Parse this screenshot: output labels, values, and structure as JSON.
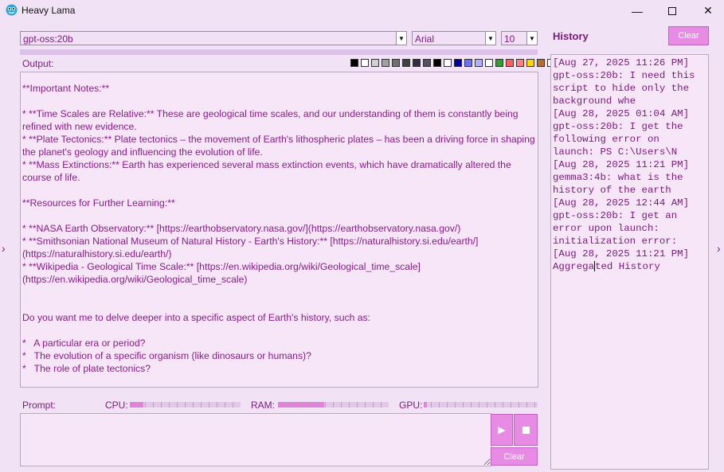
{
  "window": {
    "title": "Heavy Lama",
    "app_icon": "llama-icon",
    "minimize_glyph": "—",
    "close_glyph": "✕"
  },
  "toolbar": {
    "model": "gpt-oss:20b",
    "font": "Arial",
    "font_size": "10",
    "dropdown_glyph": "▼"
  },
  "output": {
    "label": "Output:",
    "color_swatches": [
      "#000000",
      "#ffffff",
      "#d0d0d0",
      "#a0a0a0",
      "#707070",
      "#404040",
      "#303040",
      "#505060",
      "#000000",
      "#ffffff",
      "#0000a0",
      "#7070ff",
      "#b0b0ff",
      "#ffffff",
      "#30a030",
      "#ff6060",
      "#ff8080",
      "#ffd700",
      "#b07030",
      "#ffffff"
    ],
    "text": "**Important Notes:**\n\n* **Time Scales are Relative:** These are geological time scales, and our understanding of them is constantly being refined with new evidence.\n* **Plate Tectonics:** Plate tectonics – the movement of Earth's lithospheric plates – has been a driving force in shaping the planet's geology and influencing the evolution of life.\n* **Mass Extinctions:** Earth has experienced several mass extinction events, which have dramatically altered the course of life.\n\n**Resources for Further Learning:**\n\n* **NASA Earth Observatory:** [https://earthobservatory.nasa.gov/](https://earthobservatory.nasa.gov/)\n* **Smithsonian National Museum of Natural History - Earth's History:** [https://naturalhistory.si.edu/earth/](https://naturalhistory.si.edu/earth/)\n* **Wikipedia - Geological Time Scale:** [https://en.wikipedia.org/wiki/Geological_time_scale](https://en.wikipedia.org/wiki/Geological_time_scale)\n\n\nDo you want me to delve deeper into a specific aspect of Earth's history, such as:\n\n*   A particular era or period?\n*   The evolution of a specific organism (like dinosaurs or humans)?\n*   The role of plate tectonics?"
  },
  "status": {
    "prompt_label": "Prompt:",
    "cpu_label": "CPU:",
    "cpu_level": 0.12,
    "ram_label": "RAM:",
    "ram_level": 0.42,
    "gpu_label": "GPU:",
    "gpu_level": 0.03
  },
  "prompt": {
    "value": "",
    "send_glyph": "▶",
    "clear_label": "Clear"
  },
  "history": {
    "title": "History",
    "clear_label": "Clear",
    "lines": [
      "[Aug 27, 2025 11:26 PM]",
      "gpt-oss:20b: I need this",
      "script to hide only the",
      "background whe",
      "[Aug 28, 2025 01:04 AM]",
      "gpt-oss:20b: I get the",
      "following error on",
      "launch: PS C:\\Users\\N",
      "[Aug 28, 2025 11:21 PM]",
      "gemma3:4b: what is the",
      "history of the earth",
      "[Aug 28, 2025 12:44 AM]",
      "gpt-oss:20b: I get an",
      "error upon launch:",
      "initialization error:",
      "[Aug 28, 2025 11:21 PM]"
    ],
    "last_line_a": "Aggrega",
    "last_line_b": "ted History"
  },
  "nav": {
    "left_glyph": "›",
    "right_glyph": "›"
  }
}
